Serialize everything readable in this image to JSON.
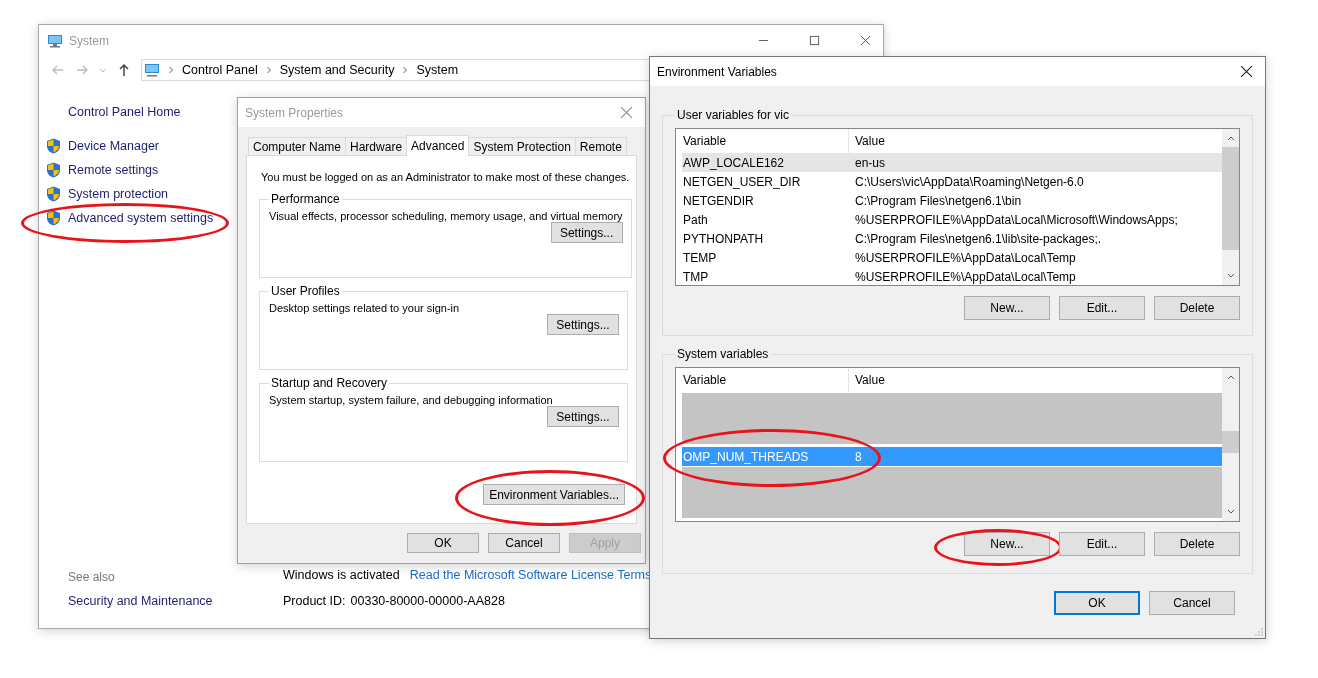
{
  "system_window": {
    "title": "System",
    "breadcrumb": [
      "Control Panel",
      "System and Security",
      "System"
    ],
    "sidebar": {
      "home": "Control Panel Home",
      "links": [
        {
          "label": "Device Manager",
          "circled": false
        },
        {
          "label": "Remote settings",
          "circled": false
        },
        {
          "label": "System protection",
          "circled": false
        },
        {
          "label": "Advanced system settings",
          "circled": true
        }
      ]
    },
    "see_also": {
      "heading": "See also",
      "links": [
        "Security and Maintenance"
      ]
    },
    "activation": {
      "status": "Windows is activated",
      "link": "Read the Microsoft Software License Terms"
    },
    "product_id": {
      "label": "Product ID:",
      "value": "00330-80000-00000-AA828"
    }
  },
  "system_properties": {
    "title": "System Properties",
    "tabs": [
      {
        "label": "Computer Name",
        "selected": false
      },
      {
        "label": "Hardware",
        "selected": false
      },
      {
        "label": "Advanced",
        "selected": true
      },
      {
        "label": "System Protection",
        "selected": false
      },
      {
        "label": "Remote",
        "selected": false
      }
    ],
    "notice": "You must be logged on as an Administrator to make most of these changes.",
    "groups": [
      {
        "title": "Performance",
        "description": "Visual effects, processor scheduling, memory usage, and virtual memory",
        "button": "Settings..."
      },
      {
        "title": "User Profiles",
        "description": "Desktop settings related to your sign-in",
        "button": "Settings..."
      },
      {
        "title": "Startup and Recovery",
        "description": "System startup, system failure, and debugging information",
        "button": "Settings..."
      }
    ],
    "env_button": {
      "label": "Environment Variables...",
      "circled": true
    },
    "buttons": [
      {
        "label": "OK",
        "disabled": false
      },
      {
        "label": "Cancel",
        "disabled": false
      },
      {
        "label": "Apply",
        "disabled": true
      }
    ]
  },
  "environment_variables": {
    "title": "Environment Variables",
    "sections": [
      {
        "title": "User variables for vic",
        "columns": [
          "Variable",
          "Value"
        ],
        "rows": [
          {
            "kind": "variable",
            "variable": "AWP_LOCALE162",
            "value": "en-us",
            "selected": false,
            "hovered": true,
            "circled": false
          },
          {
            "kind": "variable",
            "variable": "NETGEN_USER_DIR",
            "value": "C:\\Users\\vic\\AppData\\Roaming\\Netgen-6.0",
            "selected": false,
            "hovered": false,
            "circled": false
          },
          {
            "kind": "variable",
            "variable": "NETGENDIR",
            "value": "C:\\Program Files\\netgen6.1\\bin",
            "selected": false,
            "hovered": false,
            "circled": false
          },
          {
            "kind": "variable",
            "variable": "Path",
            "value": "%USERPROFILE%\\AppData\\Local\\Microsoft\\WindowsApps;",
            "selected": false,
            "hovered": false,
            "circled": false
          },
          {
            "kind": "variable",
            "variable": "PYTHONPATH",
            "value": "C:\\Program Files\\netgen6.1\\lib\\site-packages;.",
            "selected": false,
            "hovered": false,
            "circled": false
          },
          {
            "kind": "variable",
            "variable": "TEMP",
            "value": "%USERPROFILE%\\AppData\\Local\\Temp",
            "selected": false,
            "hovered": false,
            "circled": false
          },
          {
            "kind": "variable",
            "variable": "TMP",
            "value": "%USERPROFILE%\\AppData\\Local\\Temp",
            "selected": false,
            "hovered": false,
            "circled": false
          }
        ],
        "buttons": [
          {
            "label": "New...",
            "circled": false
          },
          {
            "label": "Edit...",
            "circled": false
          },
          {
            "label": "Delete",
            "circled": false
          }
        ]
      },
      {
        "title": "System variables",
        "columns": [
          "Variable",
          "Value"
        ],
        "rows": [
          {
            "kind": "redacted"
          },
          {
            "kind": "variable",
            "variable": "OMP_NUM_THREADS",
            "value": "8",
            "selected": true,
            "circled": true
          },
          {
            "kind": "redacted"
          }
        ],
        "buttons": [
          {
            "label": "New...",
            "circled": true
          },
          {
            "label": "Edit...",
            "circled": false
          },
          {
            "label": "Delete",
            "circled": false
          }
        ]
      }
    ],
    "buttons": [
      {
        "label": "OK",
        "default": true
      },
      {
        "label": "Cancel",
        "default": false
      }
    ]
  }
}
